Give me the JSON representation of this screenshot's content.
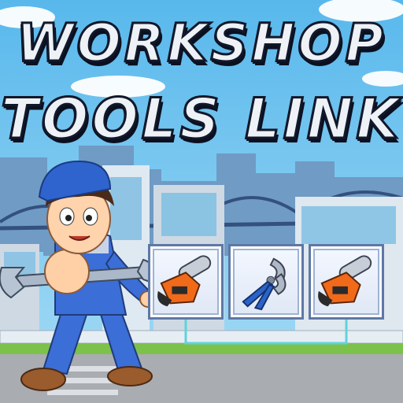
{
  "game": {
    "title_line1": "WORKSHOP",
    "title_line2": "TOOLS LINK"
  },
  "board": {
    "tiles": [
      {
        "icon": "chainsaw-icon"
      },
      {
        "icon": "pliers-icon"
      },
      {
        "icon": "chainsaw-icon"
      }
    ]
  },
  "colors": {
    "sky": "#6ec3ee",
    "title_fill": "#eef2f7",
    "title_outline": "#11182a",
    "tile_border": "#5e78a6",
    "connector_line": "#5fd3dc",
    "chainsaw_orange": "#f06a1a",
    "pliers_blue": "#2a63c9",
    "overalls": "#3b6ed6",
    "cap": "#2f64cf"
  }
}
